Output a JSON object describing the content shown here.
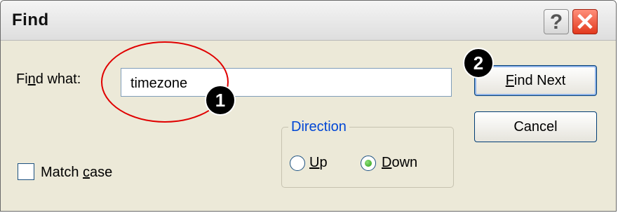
{
  "window": {
    "title": "Find",
    "help_glyph": "?",
    "close_glyph": "✕"
  },
  "find_what": {
    "label_before": "Fi",
    "label_accel": "n",
    "label_after": "d what:",
    "value": "timezone"
  },
  "buttons": {
    "find_next_accel": "F",
    "find_next_rest": "ind Next",
    "cancel": "Cancel"
  },
  "direction": {
    "label": "Direction",
    "up_accel": "U",
    "up_rest": "p",
    "down_accel": "D",
    "down_rest": "own",
    "selected": "Down"
  },
  "match_case": {
    "before": "Match ",
    "accel": "c",
    "after": "ase",
    "checked": false
  },
  "annotations": {
    "badge_1": "1",
    "badge_2": "2"
  },
  "colors": {
    "highlight_ring": "#e00000",
    "direction_label": "#0046d5",
    "radio_selected": "#2c9e15"
  },
  "icons": [
    "help-icon",
    "close-icon"
  ]
}
